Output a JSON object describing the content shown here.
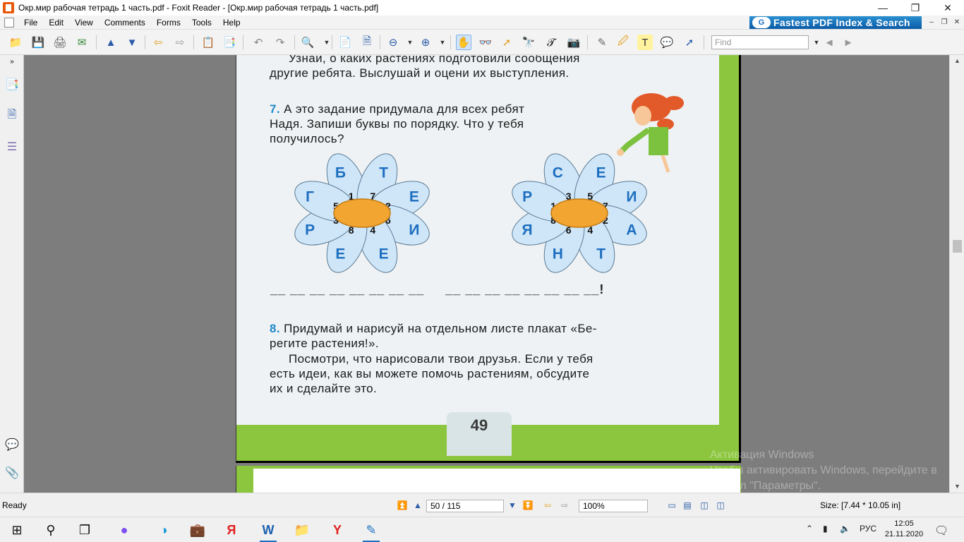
{
  "window": {
    "title": "Окр.мир рабочая тетрадь 1 часть.pdf - Foxit Reader - [Окр.мир рабочая тетрадь 1 часть.pdf]"
  },
  "menu": {
    "items": [
      "File",
      "Edit",
      "View",
      "Comments",
      "Forms",
      "Tools",
      "Help"
    ],
    "ad_text": "Fastest PDF Index & Search"
  },
  "toolbar": {
    "find_placeholder": "Find"
  },
  "document": {
    "text_top": [
      "Узнай, о каких растениях подготовили сообщения",
      "другие ребята. Выслушай и оцени их выступления."
    ],
    "task7": {
      "number": "7.",
      "lines": [
        "А это задание придумала для всех ребят",
        "Надя. Запиши буквы по порядку. Что у тебя",
        "получилось?"
      ]
    },
    "flower1": {
      "petals": [
        {
          "letter": "Б",
          "num": "1"
        },
        {
          "letter": "Т",
          "num": "7"
        },
        {
          "letter": "Е",
          "num": "2"
        },
        {
          "letter": "И",
          "num": "6"
        },
        {
          "letter": "Е",
          "num": "4"
        },
        {
          "letter": "Е",
          "num": "8"
        },
        {
          "letter": "Р",
          "num": "3"
        },
        {
          "letter": "Г",
          "num": "5"
        }
      ]
    },
    "flower2": {
      "petals": [
        {
          "letter": "С",
          "num": "3"
        },
        {
          "letter": "Е",
          "num": "5"
        },
        {
          "letter": "И",
          "num": "7"
        },
        {
          "letter": "А",
          "num": "2"
        },
        {
          "letter": "Т",
          "num": "4"
        },
        {
          "letter": "Н",
          "num": "6"
        },
        {
          "letter": "Я",
          "num": "8"
        },
        {
          "letter": "Р",
          "num": "1"
        }
      ]
    },
    "answer_blanks": "__ __ __ __ __ __ __ __     __ __ __ __ __ __ __ __!",
    "task8": {
      "number": "8.",
      "lines": [
        "Придумай и нарисуй на отдельном листе плакат «Бе-",
        "регите растения!»."
      ],
      "para": [
        "Посмотри, что нарисовали твои друзья. Если у тебя",
        "есть идеи, как вы можете помочь растениям, обсудите",
        "их и сделайте это."
      ]
    },
    "page_number": "49",
    "watermark": [
      "Активация Windows",
      "Чтобы активировать Windows, перейдите в",
      "раздел \"Параметры\"."
    ]
  },
  "statusbar": {
    "ready": "Ready",
    "page_field": "50 / 115",
    "zoom": "100%",
    "size": "Size: [7.44 * 10.05 in]"
  },
  "taskbar": {
    "lang": "РУС",
    "time": "12:05",
    "date": "21.11.2020"
  },
  "colors": {
    "page_green": "#8cc63f",
    "viewer_bg": "#7d7d7d",
    "petal_blue": "#5aa6e0",
    "letter_blue": "#1e6fc0"
  }
}
